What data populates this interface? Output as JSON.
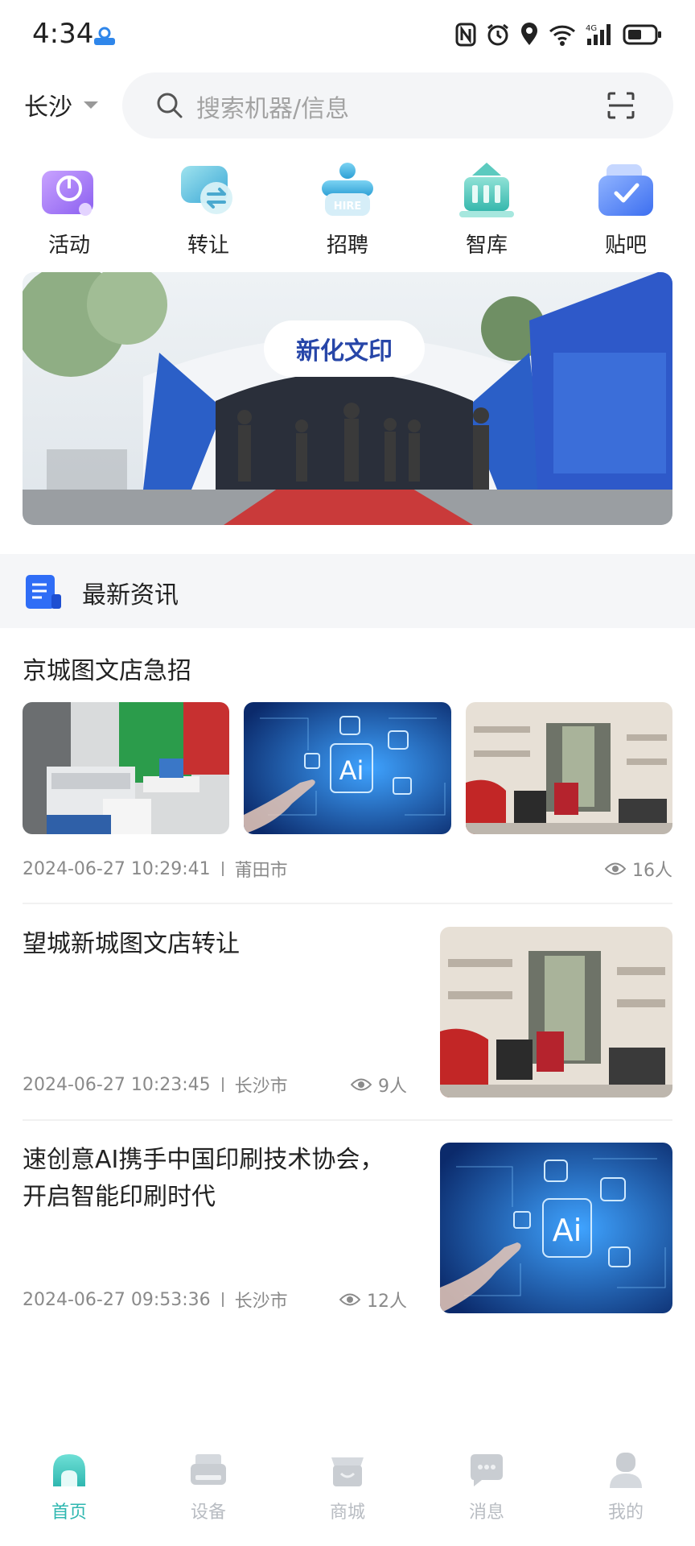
{
  "status_bar": {
    "time": "4:34"
  },
  "header": {
    "city": "长沙",
    "search_placeholder": "搜索机器/信息"
  },
  "categories": [
    {
      "label": "活动",
      "icon": "activity-icon",
      "color": "#9b6cf0"
    },
    {
      "label": "转让",
      "icon": "transfer-icon",
      "color": "#35b8cc"
    },
    {
      "label": "招聘",
      "icon": "hire-icon",
      "color": "#3fa9d8"
    },
    {
      "label": "智库",
      "icon": "library-icon",
      "color": "#3fc3b8"
    },
    {
      "label": "贴吧",
      "icon": "forum-icon",
      "color": "#4a7ff0"
    }
  ],
  "banner": {
    "sign_text": "新化文印"
  },
  "section": {
    "title": "最新资讯"
  },
  "news": [
    {
      "title": "京城图文店急招",
      "datetime": "2024-06-27 10:29:41",
      "city": "莆田市",
      "views": "16人"
    },
    {
      "title": "望城新城图文店转让",
      "datetime": "2024-06-27 10:23:45",
      "city": "长沙市",
      "views": "9人"
    },
    {
      "title": "速创意AI携手中国印刷技术协会，开启智能印刷时代",
      "datetime": "2024-06-27 09:53:36",
      "city": "长沙市",
      "views": "12人"
    }
  ],
  "thumb_text": {
    "ai": "Ai"
  },
  "nav": [
    {
      "label": "首页",
      "icon": "home-icon",
      "active": true
    },
    {
      "label": "设备",
      "icon": "device-icon",
      "active": false
    },
    {
      "label": "商城",
      "icon": "store-icon",
      "active": false
    },
    {
      "label": "消息",
      "icon": "message-icon",
      "active": false
    },
    {
      "label": "我的",
      "icon": "profile-icon",
      "active": false
    }
  ],
  "colors": {
    "accent": "#2fb7b0",
    "inactive_nav": "#c9cdd2",
    "doc_blue": "#2f6df6"
  }
}
